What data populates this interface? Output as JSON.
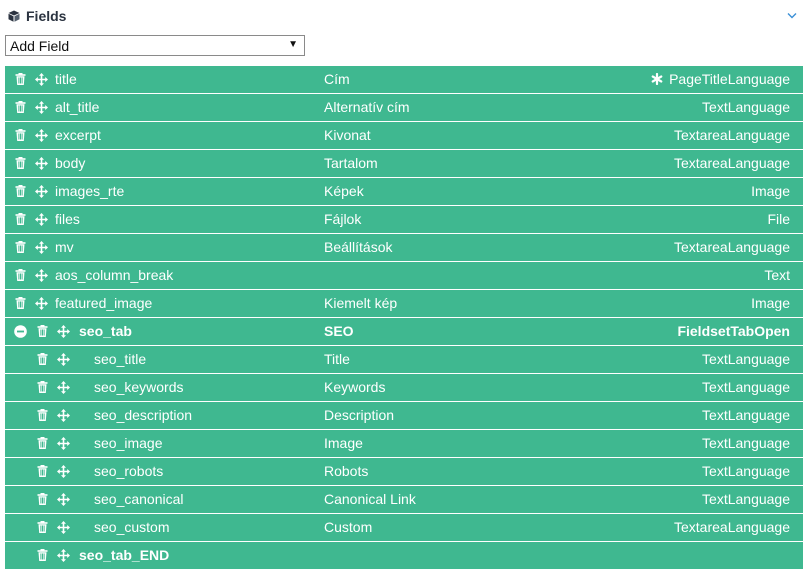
{
  "panel": {
    "title": "Fields"
  },
  "add_field": {
    "selected": "Add Field"
  },
  "fields": [
    {
      "name": "title",
      "label": "Cím",
      "type": "PageTitleLanguage",
      "required": true,
      "level": 0
    },
    {
      "name": "alt_title",
      "label": "Alternatív cím",
      "type": "TextLanguage",
      "level": 0
    },
    {
      "name": "excerpt",
      "label": "Kivonat",
      "type": "TextareaLanguage",
      "level": 0
    },
    {
      "name": "body",
      "label": "Tartalom",
      "type": "TextareaLanguage",
      "level": 0
    },
    {
      "name": "images_rte",
      "label": "Képek",
      "type": "Image",
      "level": 0
    },
    {
      "name": "files",
      "label": "Fájlok",
      "type": "File",
      "level": 0
    },
    {
      "name": "mv",
      "label": "Beállítások",
      "type": "TextareaLanguage",
      "level": 0
    },
    {
      "name": "aos_column_break",
      "label": "",
      "type": "Text",
      "level": 0
    },
    {
      "name": "featured_image",
      "label": "Kiemelt kép",
      "type": "Image",
      "level": 0
    },
    {
      "name": "seo_tab",
      "label": "SEO",
      "type": "FieldsetTabOpen",
      "level": 0,
      "group_open": true,
      "bold": true
    },
    {
      "name": "seo_title",
      "label": "Title",
      "type": "TextLanguage",
      "level": 1
    },
    {
      "name": "seo_keywords",
      "label": "Keywords",
      "type": "TextLanguage",
      "level": 1
    },
    {
      "name": "seo_description",
      "label": "Description",
      "type": "TextLanguage",
      "level": 1
    },
    {
      "name": "seo_image",
      "label": "Image",
      "type": "TextLanguage",
      "level": 1
    },
    {
      "name": "seo_robots",
      "label": "Robots",
      "type": "TextLanguage",
      "level": 1
    },
    {
      "name": "seo_canonical",
      "label": "Canonical Link",
      "type": "TextLanguage",
      "level": 1
    },
    {
      "name": "seo_custom",
      "label": "Custom",
      "type": "TextareaLanguage",
      "level": 1
    },
    {
      "name": "seo_tab_END",
      "label": "",
      "type": "",
      "level": 0,
      "group_end": true,
      "bold": true
    }
  ],
  "colors": {
    "row_bg": "#3fb890",
    "row_text": "#ffffff",
    "header_text": "#2b3340",
    "chevron": "#3a8fd6"
  },
  "icons": {
    "panel": "cube-icon",
    "collapse": "chevron-down-icon",
    "delete": "trash-icon",
    "drag": "move-icon",
    "required": "asterisk-icon",
    "group": "minus-circle-icon"
  }
}
